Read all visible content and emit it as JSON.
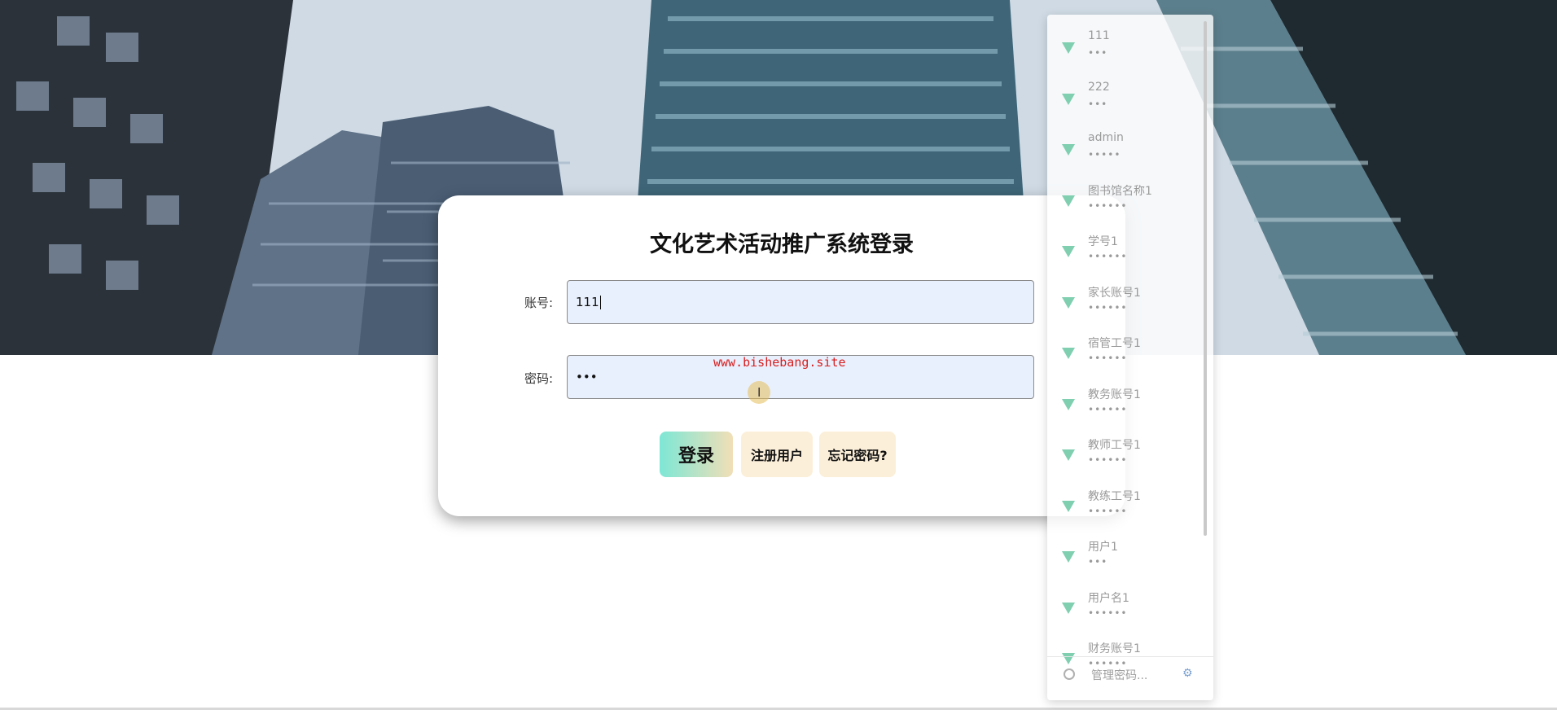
{
  "login": {
    "title": "文化艺术活动推广系统登录",
    "account_label": "账号:",
    "account_value": "111",
    "password_label": "密码:",
    "password_value": "•••",
    "watermark": "www.bishebang.site",
    "login_button": "登录",
    "register_button": "注册用户",
    "forgot_button": "忘记密码?"
  },
  "password_manager": {
    "items": [
      {
        "username": "111",
        "password": "•••"
      },
      {
        "username": "222",
        "password": "•••"
      },
      {
        "username": "admin",
        "password": "•••••"
      },
      {
        "username": "图书馆名称1",
        "password": "••••••"
      },
      {
        "username": "学号1",
        "password": "••••••"
      },
      {
        "username": "家长账号1",
        "password": "••••••"
      },
      {
        "username": "宿管工号1",
        "password": "••••••"
      },
      {
        "username": "教务账号1",
        "password": "••••••"
      },
      {
        "username": "教师工号1",
        "password": "••••••"
      },
      {
        "username": "教练工号1",
        "password": "••••••"
      },
      {
        "username": "用户1",
        "password": "•••"
      },
      {
        "username": "用户名1",
        "password": "••••••"
      },
      {
        "username": "财务账号1",
        "password": "••••••"
      }
    ],
    "manage_label": "管理密码...",
    "gear_icon": "gear-icon"
  },
  "colors": {
    "login_gradient_start": "#7de7d6",
    "login_gradient_end": "#f1dfb6",
    "secondary_button": "#fcefd9",
    "input_bg": "#e8f0fd",
    "watermark": "#d81e1e",
    "key_icon": "#7fcfb0"
  }
}
